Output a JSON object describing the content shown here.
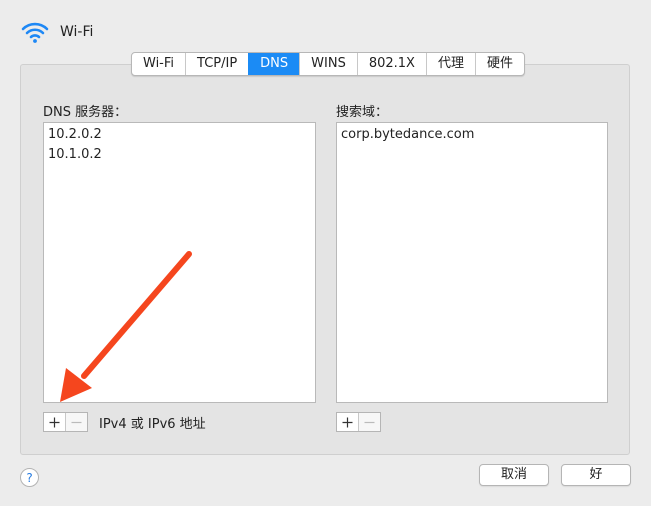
{
  "header": {
    "title": "Wi-Fi",
    "icon": "wifi-icon",
    "accent": "#1e88f5"
  },
  "tabs": [
    {
      "label": "Wi-Fi",
      "active": false
    },
    {
      "label": "TCP/IP",
      "active": false
    },
    {
      "label": "DNS",
      "active": true
    },
    {
      "label": "WINS",
      "active": false
    },
    {
      "label": "802.1X",
      "active": false
    },
    {
      "label": "代理",
      "active": false
    },
    {
      "label": "硬件",
      "active": false
    }
  ],
  "dns": {
    "label": "DNS 服务器：",
    "servers": [
      "10.2.0.2",
      "10.1.0.2"
    ],
    "hint": "IPv4 或 IPv6 地址"
  },
  "search": {
    "label": "搜索域：",
    "domains": [
      "corp.bytedance.com"
    ]
  },
  "footer": {
    "cancel_label": "取消",
    "ok_label": "好",
    "help_label": "?"
  },
  "annotation": {
    "arrow_color": "#f5461e"
  }
}
